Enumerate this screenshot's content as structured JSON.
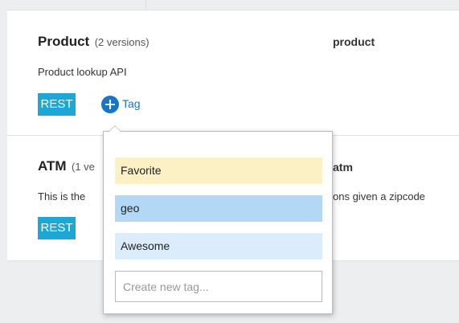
{
  "apis": [
    {
      "name": "Product",
      "versions": "(2 versions)",
      "id": "product",
      "description": "Product lookup API",
      "badge": "REST",
      "add_tag_label": "Tag"
    },
    {
      "name": "ATM",
      "versions": "(1 ve",
      "id": "atm",
      "description_left": "This is the",
      "description_right": "ons given a zipcode",
      "badge": "REST"
    }
  ],
  "tag_popover": {
    "options": [
      "Favorite",
      "geo",
      "Awesome"
    ],
    "option_colors": [
      "#fcf0c5",
      "#b3d8f5",
      "#dbedfc"
    ],
    "new_tag_placeholder": "Create new tag..."
  },
  "colors": {
    "accent": "#1477cc",
    "badge": "#1ba8d7"
  }
}
